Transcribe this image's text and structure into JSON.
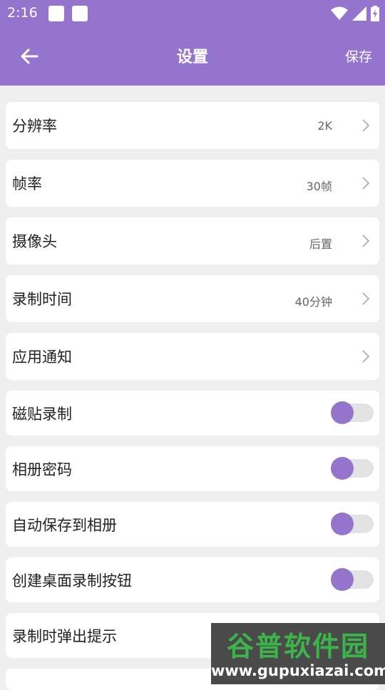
{
  "status_bar": {
    "time": "2:16",
    "icons": [
      "notification-square-icon",
      "notification-square-icon",
      "wifi-icon",
      "signal-icon",
      "battery-charging-icon"
    ]
  },
  "header": {
    "title": "设置",
    "save_label": "保存",
    "back_icon": "arrow-left-icon",
    "background": "#9474cc"
  },
  "settings": [
    {
      "label": "分辨率",
      "value": "2K",
      "type": "nav"
    },
    {
      "label": "帧率",
      "value": "30帧",
      "type": "nav"
    },
    {
      "label": "摄像头",
      "value": "后置",
      "type": "nav"
    },
    {
      "label": "录制时间",
      "value": "40分钟",
      "type": "nav"
    },
    {
      "label": "应用通知",
      "value": "",
      "type": "nav"
    },
    {
      "label": "磁贴录制",
      "type": "toggle",
      "on": false
    },
    {
      "label": "相册密码",
      "type": "toggle",
      "on": false
    },
    {
      "label": "自动保存到相册",
      "type": "toggle",
      "on": false
    },
    {
      "label": "创建桌面录制按钮",
      "type": "toggle",
      "on": false
    },
    {
      "label": "录制时弹出提示",
      "type": "toggle",
      "on": true
    }
  ],
  "watermark": {
    "title": "谷普软件园",
    "url": "www.gupuxiazai.com"
  },
  "colors": {
    "accent": "#9474cc",
    "toggle_on": "#2e9a55",
    "toggle_off_track": "#e3e3e3"
  }
}
